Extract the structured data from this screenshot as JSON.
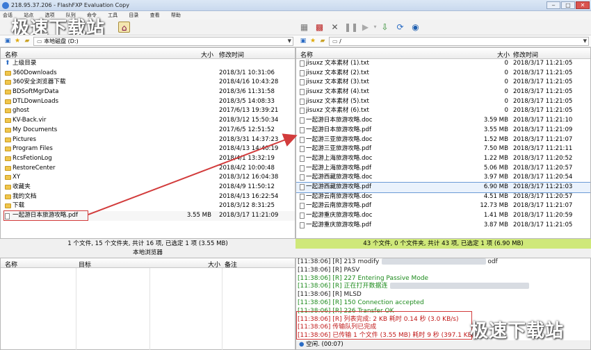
{
  "window": {
    "title": "218.95.37.206 - FlashFXP Evaluation Copy",
    "min": "‒",
    "max": "□",
    "close": "✕"
  },
  "menu": [
    "会话",
    "站点",
    "选项",
    "队列",
    "命令",
    "工具",
    "目录",
    "查看",
    "帮助"
  ],
  "watermark": "极速下载站",
  "left": {
    "path": "本地磁盘 (D:)",
    "headers": {
      "name": "名称",
      "size": "大小",
      "date": "修改时间"
    },
    "rows": [
      {
        "icon": "up",
        "name": "上级目录",
        "size": "",
        "date": ""
      },
      {
        "icon": "folder",
        "name": "360Downloads",
        "size": "",
        "date": "2018/3/1 10:31:06"
      },
      {
        "icon": "folder",
        "name": "360安全浏览器下载",
        "size": "",
        "date": "2018/4/16 10:43:28"
      },
      {
        "icon": "folder",
        "name": "BDSoftMgrData",
        "size": "",
        "date": "2018/3/6 11:31:58"
      },
      {
        "icon": "folder",
        "name": "DTLDownLoads",
        "size": "",
        "date": "2018/3/5 14:08:33"
      },
      {
        "icon": "folder",
        "name": "ghost",
        "size": "",
        "date": "2017/6/13 19:39:21"
      },
      {
        "icon": "folder",
        "name": "KV-Back.vir",
        "size": "",
        "date": "2018/3/12 15:50:34"
      },
      {
        "icon": "folder",
        "name": "My Documents",
        "size": "",
        "date": "2017/6/5 12:51:52"
      },
      {
        "icon": "folder",
        "name": "Pictures",
        "size": "",
        "date": "2018/3/31 14:37:23"
      },
      {
        "icon": "folder",
        "name": "Program Files",
        "size": "",
        "date": "2018/4/13 14:40:19"
      },
      {
        "icon": "folder",
        "name": "RcsFetionLog",
        "size": "",
        "date": "2018/4/1 13:32:19"
      },
      {
        "icon": "folder",
        "name": "RestoreCenter",
        "size": "",
        "date": "2018/4/2 10:00:48"
      },
      {
        "icon": "folder",
        "name": "XY",
        "size": "",
        "date": "2018/3/12 16:04:38"
      },
      {
        "icon": "folder",
        "name": "收藏夹",
        "size": "",
        "date": "2018/4/9 11:50:12"
      },
      {
        "icon": "folder",
        "name": "我的文档",
        "size": "",
        "date": "2018/4/13 16:22:54"
      },
      {
        "icon": "folder",
        "name": "下载",
        "size": "",
        "date": "2018/3/12 8:31:25"
      },
      {
        "icon": "file",
        "name": "一起游日本旅游攻略.pdf",
        "size": "3.55 MB",
        "date": "2018/3/17 11:21:09"
      }
    ],
    "status": "1 个文件, 15 个文件夹, 共计 16 项, 已选定 1 项 (3.55 MB)",
    "sub": "本地浏览器"
  },
  "right": {
    "path": "/",
    "headers": {
      "name": "名称",
      "size": "大小",
      "date": "修改时间"
    },
    "rows": [
      {
        "name": "jisuxz 文本素材 (1).txt",
        "size": "0",
        "date": "2018/3/17 11:21:05"
      },
      {
        "name": "jisuxz 文本素材 (2).txt",
        "size": "0",
        "date": "2018/3/17 11:21:05"
      },
      {
        "name": "jisuxz 文本素材 (3).txt",
        "size": "0",
        "date": "2018/3/17 11:21:05"
      },
      {
        "name": "jisuxz 文本素材 (4).txt",
        "size": "0",
        "date": "2018/3/17 11:21:05"
      },
      {
        "name": "jisuxz 文本素材 (5).txt",
        "size": "0",
        "date": "2018/3/17 11:21:05"
      },
      {
        "name": "jisuxz 文本素材 (6).txt",
        "size": "0",
        "date": "2018/3/17 11:21:05"
      },
      {
        "name": "一起游日本旅游攻略.doc",
        "size": "3.59 MB",
        "date": "2018/3/17 11:21:10"
      },
      {
        "name": "一起游日本旅游攻略.pdf",
        "size": "3.55 MB",
        "date": "2018/3/17 11:21:09"
      },
      {
        "name": "一起游三亚旅游攻略.doc",
        "size": "1.52 MB",
        "date": "2018/3/17 11:21:07"
      },
      {
        "name": "一起游三亚旅游攻略.pdf",
        "size": "7.50 MB",
        "date": "2018/3/17 11:21:11"
      },
      {
        "name": "一起游上海旅游攻略.doc",
        "size": "1.22 MB",
        "date": "2018/3/17 11:20:52"
      },
      {
        "name": "一起游上海旅游攻略.pdf",
        "size": "5.06 MB",
        "date": "2018/3/17 11:20:57"
      },
      {
        "name": "一起游西藏旅游攻略.doc",
        "size": "3.97 MB",
        "date": "2018/3/17 11:20:54"
      },
      {
        "name": "一起游西藏旅游攻略.pdf",
        "size": "6.90 MB",
        "date": "2018/3/17 11:21:03"
      },
      {
        "name": "一起游云南旅游攻略.doc",
        "size": "4.51 MB",
        "date": "2018/3/17 11:20:57"
      },
      {
        "name": "一起游云南旅游攻略.pdf",
        "size": "12.73 MB",
        "date": "2018/3/17 11:21:07"
      },
      {
        "name": "一起游重庆旅游攻略.doc",
        "size": "1.41 MB",
        "date": "2018/3/17 11:20:59"
      },
      {
        "name": "一起游重庆旅游攻略.pdf",
        "size": "3.87 MB",
        "date": "2018/3/17 11:21:05"
      }
    ],
    "status": "43 个文件, 0 个文件夹, 共计 43 项, 已选定 1 项 (6.90 MB)"
  },
  "queue": {
    "headers": {
      "name": "名称",
      "target": "目标",
      "size": "大小",
      "note": "备注"
    }
  },
  "log": [
    {
      "t": "[11:38:06] [R] 213 modify",
      "tail": "odf",
      "c": "c-blk"
    },
    {
      "t": "[11:38:06] [R] PASV",
      "tail": "",
      "c": "c-blk"
    },
    {
      "t": "[11:38:06] [R] 227 Entering Passive Mode",
      "tail": "",
      "c": "c-green"
    },
    {
      "t": "[11:38:06] [R] 正在打开数据连",
      "tail": "",
      "c": "c-green"
    },
    {
      "t": "[11:38:06] [R] MLSD",
      "tail": "",
      "c": "c-blk"
    },
    {
      "t": "[11:38:06] [R] 150 Connection accepted",
      "tail": "",
      "c": "c-green"
    },
    {
      "t": "[11:38:06] [R] 226 Transfer OK",
      "tail": "",
      "c": "c-green"
    },
    {
      "t": "[11:38:06] [R] 列表完成: 2 KB 耗时 0.14 秒 (3.0 KB/s)",
      "tail": "",
      "c": "c-red"
    },
    {
      "t": "[11:38:06] 传输队列已完成",
      "tail": "",
      "c": "c-red"
    },
    {
      "t": "[11:38:06] 已传输 1 个文件 (3.55 MB) 耗时 9 秒 (397.1 KB/s)",
      "tail": "",
      "c": "c-red"
    }
  ],
  "idle": "空闲. (00:07)",
  "colors": {
    "right_status_bg": "#cfe87a",
    "highlight_red": "#d23b3b"
  }
}
